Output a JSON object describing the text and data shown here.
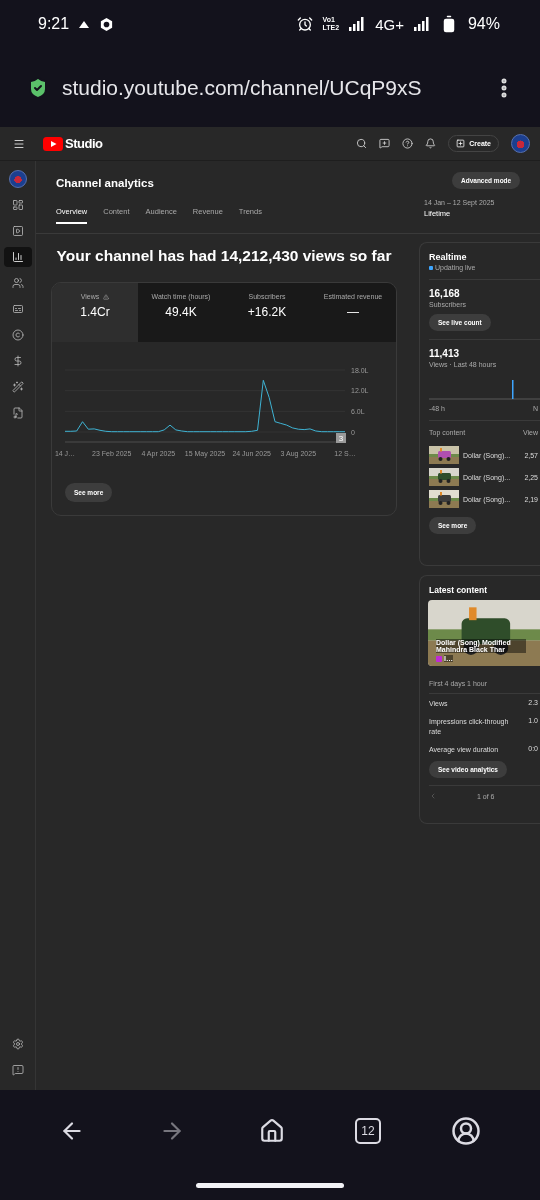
{
  "status_bar": {
    "time": "9:21",
    "volte_top": "Vo1",
    "volte_bottom": "LTE2",
    "network": "4G+",
    "battery": "94%"
  },
  "browser": {
    "url": "studio.youtube.com/channel/UCqP9xS"
  },
  "studio_header": {
    "logo": "Studio",
    "create_button": "Create"
  },
  "sidebar": {
    "items": [
      {
        "kind": "avatar",
        "selected": false
      },
      {
        "kind": "dashboard",
        "selected": false
      },
      {
        "kind": "content",
        "selected": false
      },
      {
        "kind": "analytics",
        "selected": true
      },
      {
        "kind": "community",
        "selected": false
      },
      {
        "kind": "subtitles",
        "selected": false
      },
      {
        "kind": "copyright",
        "selected": false
      },
      {
        "kind": "earn",
        "selected": false
      },
      {
        "kind": "customisation",
        "selected": false
      },
      {
        "kind": "audio",
        "selected": false
      }
    ],
    "bottom_items": [
      {
        "kind": "settings",
        "selected": false
      },
      {
        "kind": "feedback",
        "selected": false
      }
    ]
  },
  "page": {
    "title": "Channel analytics",
    "advanced_button": "Advanced mode",
    "date_range": "14 Jan – 12 Sept 2025",
    "period": "Lifetime"
  },
  "tabs": [
    {
      "label": "Overview",
      "selected": true
    },
    {
      "label": "Content",
      "selected": false
    },
    {
      "label": "Audience",
      "selected": false
    },
    {
      "label": "Revenue",
      "selected": false
    },
    {
      "label": "Trends",
      "selected": false
    }
  ],
  "headline": "Your channel has had 14,212,430 views so far",
  "metrics": [
    {
      "label": "Views",
      "value": "1.4Cr",
      "selected": true,
      "warning": true
    },
    {
      "label": "Watch time (hours)",
      "value": "49.4K",
      "selected": false,
      "warning": false
    },
    {
      "label": "Subscribers",
      "value": "+16.2K",
      "selected": false,
      "warning": false
    },
    {
      "label": "Estimated revenue",
      "value": "—",
      "selected": false,
      "warning": false
    }
  ],
  "chart_data": {
    "type": "line",
    "ylim": [
      0,
      18
    ],
    "categories": [
      "14 J…",
      null,
      null,
      null,
      null,
      null,
      null,
      null,
      "23 Feb 2025",
      null,
      null,
      null,
      null,
      null,
      null,
      null,
      "4 Apr 2025",
      null,
      null,
      null,
      null,
      null,
      null,
      null,
      "15 May 2025",
      null,
      null,
      null,
      null,
      null,
      null,
      null,
      "24 Jun 2025",
      null,
      null,
      null,
      null,
      null,
      null,
      null,
      "3 Aug 2025",
      null,
      null,
      null,
      null,
      null,
      null,
      null,
      "12 S…"
    ],
    "yticks": [
      {
        "value": 0,
        "label": "0"
      },
      {
        "value": 6,
        "label": "6.0L"
      },
      {
        "value": 12,
        "label": "12.0L"
      },
      {
        "value": 18,
        "label": "18.0L"
      }
    ],
    "series": [
      {
        "color": "#3fb3d3",
        "values": [
          0.2,
          0.2,
          0.3,
          3.0,
          0.8,
          0.9,
          0.5,
          0.2,
          0.1,
          0.1,
          0.1,
          0.1,
          0.1,
          0.1,
          0.1,
          0.1,
          0.1,
          0.6,
          2.0,
          0.6,
          0.3,
          0.1,
          0.1,
          0.1,
          0.1,
          0.1,
          0.1,
          0.1,
          0.1,
          0.1,
          0.1,
          0.1,
          0.2,
          0.5,
          15.0,
          10.0,
          3.0,
          2.5,
          2.0,
          1.2,
          0.8,
          0.7,
          0.9,
          0.3,
          0.1,
          0.1,
          0.1,
          0.1,
          0.1
        ]
      }
    ]
  },
  "chart_badge": "3",
  "see_more": "See more",
  "realtime": {
    "title": "Realtime",
    "status": "Updating live",
    "subscribers": "16,168",
    "subscribers_label": "Subscribers",
    "live_button": "See live count",
    "views": "11,413",
    "views_label": "Views · Last 48 hours",
    "axis_start": "-48 h",
    "axis_end": "N",
    "top_content_label": "Top content",
    "views_column": "View",
    "top_content": [
      {
        "title": "Dollar (Song)...",
        "views": "2,57"
      },
      {
        "title": "Dollar (Song)...",
        "views": "2,25"
      },
      {
        "title": "Dollar (Song)...",
        "views": "2,19"
      }
    ],
    "see_more": "See more"
  },
  "latest": {
    "title": "Latest content",
    "video_title": "Dollar (Song) Modified Mahindra Black Thar",
    "video_title_end": "I…",
    "period": "First 4 days 1 hour",
    "stats": [
      {
        "label": "Views",
        "value": "2.3"
      },
      {
        "label": "Impressions click-through rate",
        "value": "1.0"
      },
      {
        "label": "Average view duration",
        "value": "0:0"
      }
    ],
    "button": "See video analytics",
    "pager": "1 of 6"
  },
  "bottom_nav": {
    "tab_count": "12",
    "forward_disabled": true
  }
}
